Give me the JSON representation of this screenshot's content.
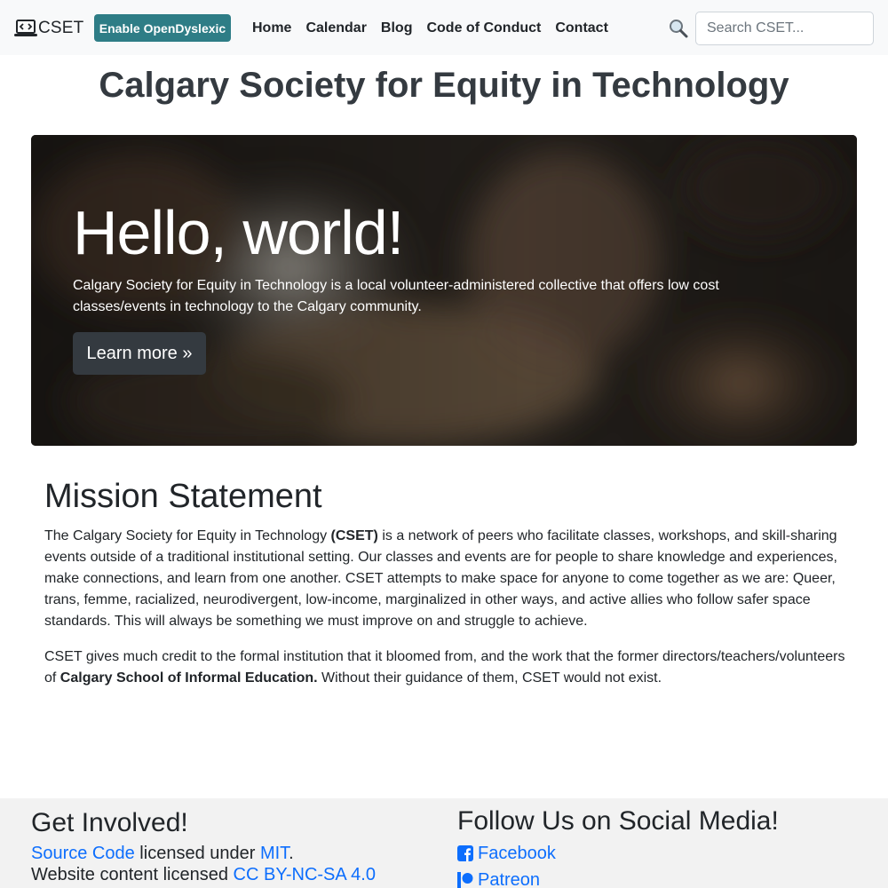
{
  "navbar": {
    "brand": "CSET",
    "dyslexic_button": "Enable OpenDyslexic",
    "links": [
      "Home",
      "Calendar",
      "Blog",
      "Code of Conduct",
      "Contact"
    ],
    "search_placeholder": "Search CSET..."
  },
  "site_title": "Calgary Society for Equity in Technology",
  "hero": {
    "heading": "Hello, world!",
    "text": "Calgary Society for Equity in Technology is a local volunteer-administered collective that offers low cost classes/events in technology to the Calgary community.",
    "button": "Learn more »"
  },
  "mission": {
    "heading": "Mission Statement",
    "p1_before": "The Calgary Society for Equity in Technology ",
    "p1_bold": "(CSET)",
    "p1_after": " is a network of peers who facilitate classes, workshops, and skill-sharing events outside of a traditional institutional setting. Our classes and events are for people to share knowledge and experiences, make connections, and learn from one another. CSET attempts to make space for anyone to come together as we are: Queer, trans, femme, racialized, neurodivergent, low-income, marginalized in other ways, and active allies who follow safer space standards. This will always be something we must improve on and struggle to achieve.",
    "p2_before": "CSET gives much credit to the formal institution that it bloomed from, and the work that the former directors/teachers/volunteers of ",
    "p2_bold": "Calgary School of Informal Education.",
    "p2_after": " Without their guidance of them, CSET would not exist."
  },
  "footer": {
    "involved": {
      "heading": "Get Involved!",
      "source_link": "Source Code",
      "licensed_under": " licensed under ",
      "mit_link": "MIT",
      "period": ".",
      "content_text": "Website content licensed ",
      "cc_link": "CC BY-NC-SA 4.0"
    },
    "social": {
      "heading": "Follow Us on Social Media!",
      "facebook": "Facebook",
      "patreon": "Patreon"
    }
  },
  "colors": {
    "dyslexic_button": "#2e7d86",
    "link": "#0d6efd",
    "hero_button": "#343a40",
    "footer_bg": "#f2f2f2"
  }
}
